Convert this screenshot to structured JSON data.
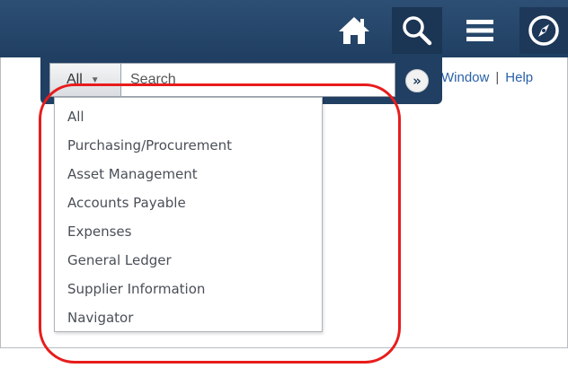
{
  "header": {
    "home_icon": "home-icon",
    "search_icon": "search-icon",
    "menu_icon": "hamburger-menu-icon",
    "navigator_icon": "compass-icon",
    "background_color": "#203f62"
  },
  "links": {
    "new_window": "w Window",
    "separator": "|",
    "help": "Help"
  },
  "search": {
    "category_selected": "All",
    "placeholder": "Search",
    "go_icon": "double-chevron-right-icon"
  },
  "dropdown": {
    "options": [
      "All",
      "Purchasing/Procurement",
      "Asset Management",
      "Accounts Payable",
      "Expenses",
      "General Ledger",
      "Supplier Information",
      "Navigator"
    ]
  },
  "annotation": {
    "highlight_color": "#e81c1c"
  }
}
